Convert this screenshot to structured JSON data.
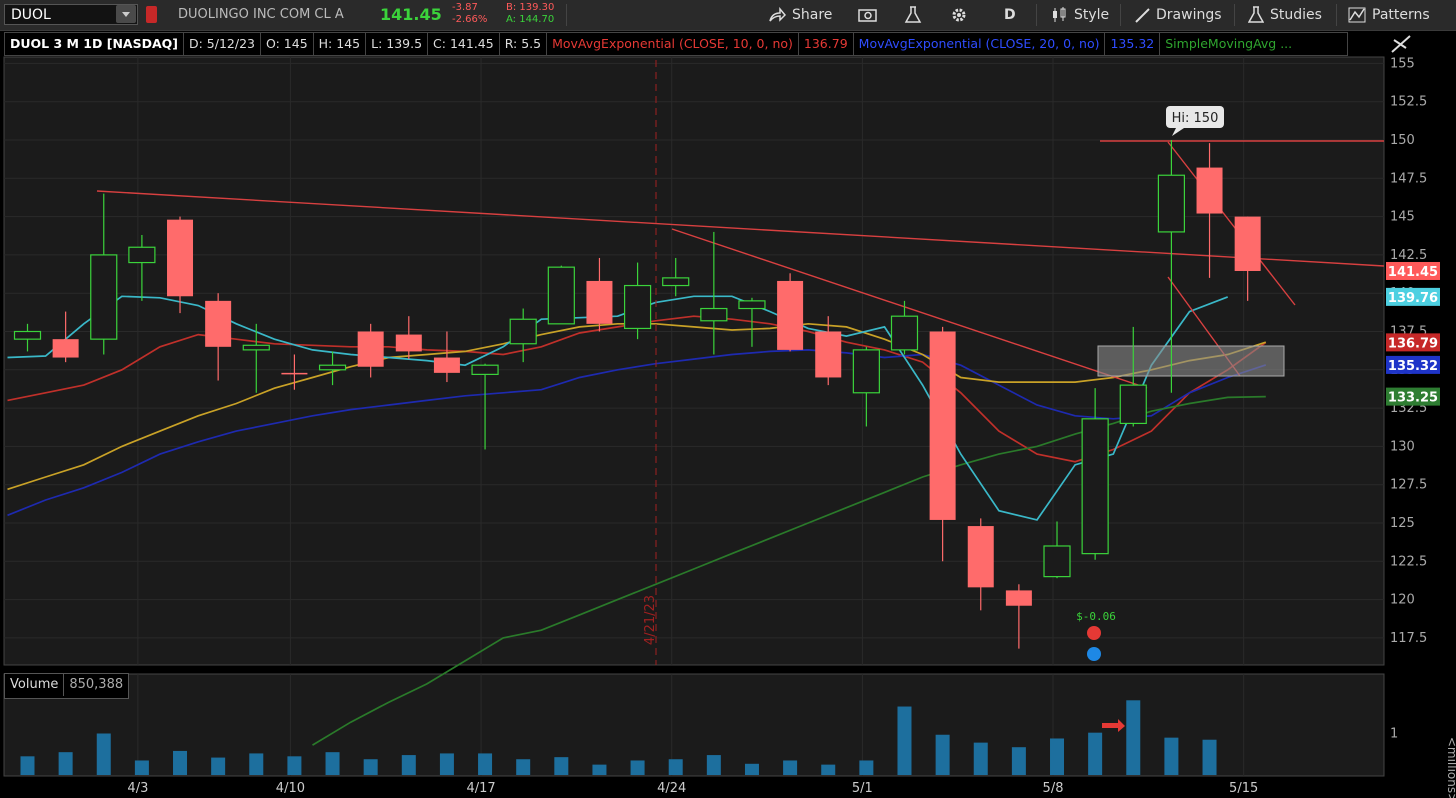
{
  "toolbar": {
    "symbol": "DUOL",
    "company": "DUOLINGO INC COM CL A",
    "last": "141.45",
    "change": "-3.87",
    "change_pct": "-2.66%",
    "bid": "B: 139.30",
    "ask": "A: 144.70",
    "share": "Share",
    "period": "D",
    "style": "Style",
    "drawings": "Drawings",
    "studies": "Studies",
    "patterns": "Patterns"
  },
  "info": {
    "title": "DUOL 3 M 1D [NASDAQ]",
    "date": "D: 5/12/23",
    "open": "O: 145",
    "high": "H: 145",
    "low": "L: 139.5",
    "close": "C: 141.45",
    "range": "R: 5.5",
    "ema10_label": "MovAvgExponential (CLOSE, 10, 0, no)",
    "ema10_value": "136.79",
    "ema20_label": "MovAvgExponential (CLOSE, 20, 0, no)",
    "ema20_value": "135.32",
    "sma_label": "SimpleMovingAvg ..."
  },
  "volume_panel": {
    "label": "Volume",
    "value": "850,388",
    "unit_label": "<millions>"
  },
  "annotations": {
    "hi_bubble": "Hi: 150",
    "event_date": "4/21/23",
    "earnings": "$-0.06"
  },
  "price_labels": [
    {
      "value": "141.45",
      "color": "#ff5a5a"
    },
    {
      "value": "139.76",
      "color": "#4dd0e1"
    },
    {
      "value": "136.79",
      "color": "#c62828"
    },
    {
      "value": "135.32",
      "color": "#1e34c8"
    },
    {
      "value": "133.25",
      "color": "#2e7d32"
    }
  ],
  "colors": {
    "up": "#3bd33b",
    "down": "#ff6b6b",
    "ema10": "#c0302a",
    "ema20": "#1e2ab0",
    "sma_yellow": "#c9a227",
    "sma_green": "#2a7a2a",
    "cyan": "#3ab8c8",
    "trend": "#e0453c",
    "volume": "#1d6f9e"
  },
  "chart_data": {
    "type": "candlestick",
    "title": "DUOL 3 M 1D [NASDAQ]",
    "ylim": [
      115,
      156
    ],
    "yticks": [
      "155",
      "152.5",
      "150",
      "147.5",
      "145",
      "142.5",
      "140",
      "137.5",
      "135",
      "132.5",
      "130",
      "127.5",
      "125",
      "122.5",
      "120",
      "117.5"
    ],
    "xticks": [
      {
        "label": "4/3",
        "index": 3
      },
      {
        "label": "4/10",
        "index": 7
      },
      {
        "label": "4/17",
        "index": 12
      },
      {
        "label": "4/24",
        "index": 17
      },
      {
        "label": "5/1",
        "index": 22
      },
      {
        "label": "5/8",
        "index": 27
      },
      {
        "label": "5/15",
        "index": 32
      }
    ],
    "candles": [
      {
        "o": 137.0,
        "h": 138.0,
        "l": 136.2,
        "c": 137.5
      },
      {
        "o": 137.0,
        "h": 138.8,
        "l": 135.5,
        "c": 135.8
      },
      {
        "o": 137.0,
        "h": 146.5,
        "l": 136.0,
        "c": 142.5
      },
      {
        "o": 142.0,
        "h": 143.8,
        "l": 139.5,
        "c": 143.0
      },
      {
        "o": 144.8,
        "h": 145.0,
        "l": 138.7,
        "c": 139.8
      },
      {
        "o": 139.5,
        "h": 140.0,
        "l": 134.3,
        "c": 136.5
      },
      {
        "o": 136.3,
        "h": 138.0,
        "l": 133.5,
        "c": 136.6
      },
      {
        "o": 134.8,
        "h": 136.0,
        "l": 133.7,
        "c": 134.7
      },
      {
        "o": 135.0,
        "h": 136.2,
        "l": 134.0,
        "c": 135.3
      },
      {
        "o": 137.5,
        "h": 138.0,
        "l": 134.5,
        "c": 135.2
      },
      {
        "o": 137.3,
        "h": 138.5,
        "l": 135.7,
        "c": 136.2
      },
      {
        "o": 135.8,
        "h": 137.5,
        "l": 134.2,
        "c": 134.8
      },
      {
        "o": 134.7,
        "h": 135.4,
        "l": 129.8,
        "c": 135.3
      },
      {
        "o": 136.7,
        "h": 139.0,
        "l": 135.5,
        "c": 138.3
      },
      {
        "o": 138.0,
        "h": 141.8,
        "l": 138.0,
        "c": 141.7
      },
      {
        "o": 140.8,
        "h": 142.3,
        "l": 137.5,
        "c": 138.0
      },
      {
        "o": 137.7,
        "h": 142.0,
        "l": 137.0,
        "c": 140.5
      },
      {
        "o": 140.5,
        "h": 142.3,
        "l": 139.8,
        "c": 141.0
      },
      {
        "o": 138.2,
        "h": 144.0,
        "l": 136.0,
        "c": 139.0
      },
      {
        "o": 139.0,
        "h": 139.7,
        "l": 136.5,
        "c": 139.5
      },
      {
        "o": 140.8,
        "h": 141.3,
        "l": 136.2,
        "c": 136.3
      },
      {
        "o": 137.5,
        "h": 138.5,
        "l": 134.0,
        "c": 134.5
      },
      {
        "o": 133.5,
        "h": 136.5,
        "l": 131.3,
        "c": 136.3
      },
      {
        "o": 136.3,
        "h": 139.5,
        "l": 136.0,
        "c": 138.5
      },
      {
        "o": 137.5,
        "h": 137.8,
        "l": 122.5,
        "c": 125.2
      },
      {
        "o": 124.8,
        "h": 125.3,
        "l": 119.3,
        "c": 120.8
      },
      {
        "o": 120.6,
        "h": 121.0,
        "l": 116.8,
        "c": 119.6
      },
      {
        "o": 121.5,
        "h": 125.1,
        "l": 121.4,
        "c": 123.5
      },
      {
        "o": 123.0,
        "h": 133.8,
        "l": 122.6,
        "c": 131.8
      },
      {
        "o": 131.5,
        "h": 137.8,
        "l": 131.3,
        "c": 134.0
      },
      {
        "o": 144.0,
        "h": 150.0,
        "l": 133.5,
        "c": 147.7
      },
      {
        "o": 148.2,
        "h": 149.8,
        "l": 141.0,
        "c": 145.2
      },
      {
        "o": 145.0,
        "h": 145.0,
        "l": 139.5,
        "c": 141.45
      }
    ],
    "series": [
      {
        "name": "MovAvgExponential (CLOSE, 10, 0, no)",
        "values": [
          133.0,
          133.5,
          134.0,
          135.0,
          136.5,
          137.3,
          137.0,
          136.7,
          136.6,
          136.5,
          136.5,
          136.3,
          136.2,
          136.0,
          136.5,
          137.4,
          137.8,
          138.2,
          138.5,
          138.3,
          138.0,
          137.5,
          136.8,
          136.3,
          135.5,
          133.5,
          131.0,
          129.5,
          129.0,
          129.8,
          131.0,
          133.5,
          135.0,
          136.79
        ]
      },
      {
        "name": "MovAvgExponential (CLOSE, 20, 0, no)",
        "values": [
          125.5,
          126.5,
          127.3,
          128.3,
          129.5,
          130.3,
          131.0,
          131.5,
          132.0,
          132.4,
          132.7,
          133.0,
          133.3,
          133.5,
          133.7,
          134.5,
          135.0,
          135.4,
          135.7,
          136.0,
          136.2,
          136.3,
          136.1,
          135.8,
          136.0,
          135.3,
          134.0,
          132.7,
          132.0,
          131.8,
          132.0,
          133.5,
          134.5,
          135.32
        ]
      },
      {
        "name": "SimpleMovingAvg ...",
        "values": [
          127.2,
          128.0,
          128.8,
          130.0,
          131.0,
          132.0,
          132.8,
          133.8,
          134.5,
          135.2,
          135.8,
          136.0,
          136.2,
          136.7,
          137.3,
          137.8,
          138.0,
          138.0,
          137.8,
          137.6,
          137.7,
          138.0,
          137.8,
          137.0,
          136.0,
          134.5,
          134.2,
          134.2,
          134.2,
          134.5,
          135.0,
          135.6,
          136.0,
          136.8
        ]
      },
      {
        "name": "SimpleMovingAvg ...",
        "values": [
          null,
          null,
          null,
          null,
          null,
          null,
          null,
          null,
          110.5,
          112.0,
          113.3,
          114.5,
          116.0,
          117.5,
          118.0,
          119.0,
          120.0,
          121.0,
          122.0,
          123.0,
          124.0,
          125.0,
          126.0,
          127.0,
          128.0,
          128.8,
          129.5,
          130.0,
          130.8,
          131.5,
          132.3,
          132.8,
          133.2,
          133.25
        ]
      },
      {
        "name": "cyan",
        "values": [
          135.8,
          135.9,
          138.0,
          139.8,
          139.7,
          139.2,
          138.0,
          137.0,
          136.3,
          136.0,
          135.8,
          135.6,
          135.3,
          136.5,
          138.3,
          138.4,
          138.5,
          139.4,
          139.8,
          139.8,
          138.8,
          137.7,
          137.2,
          137.8,
          134.0,
          129.5,
          125.8,
          125.2,
          128.8,
          129.5,
          135.3,
          138.8,
          139.76
        ]
      }
    ],
    "volume": {
      "ylim": [
        0,
        2.0
      ],
      "yticks": [
        "1"
      ],
      "values": [
        0.45,
        0.55,
        1.0,
        0.35,
        0.58,
        0.42,
        0.52,
        0.45,
        0.55,
        0.38,
        0.48,
        0.52,
        0.52,
        0.38,
        0.43,
        0.25,
        0.35,
        0.38,
        0.48,
        0.27,
        0.35,
        0.25,
        0.35,
        1.65,
        0.97,
        0.78,
        0.67,
        0.88,
        1.02,
        1.8,
        0.9,
        0.85
      ]
    }
  }
}
